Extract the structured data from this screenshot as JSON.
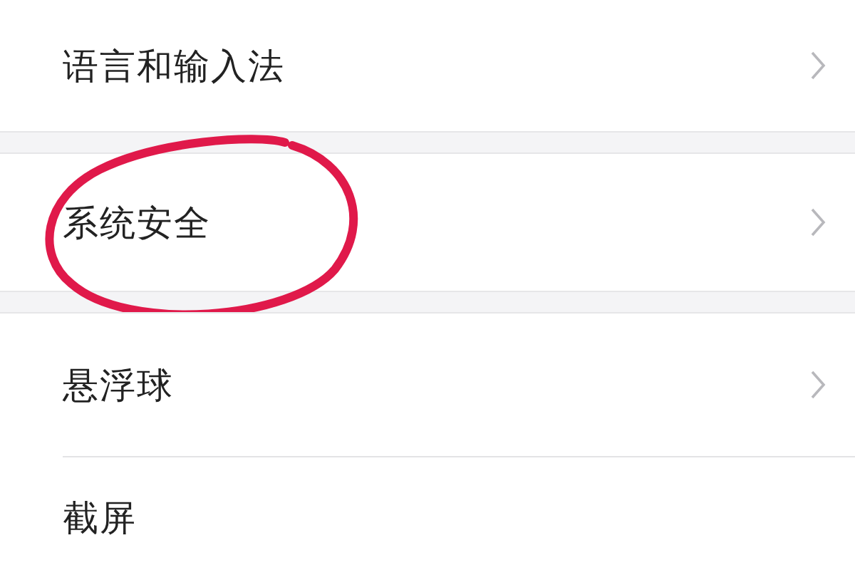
{
  "groups": [
    {
      "items": [
        {
          "label": "语言和输入法",
          "chevron": true
        }
      ]
    },
    {
      "items": [
        {
          "label": "系统安全",
          "chevron": true,
          "circled": true
        }
      ]
    },
    {
      "items": [
        {
          "label": "悬浮球",
          "chevron": true
        },
        {
          "label": "截屏",
          "chevron": false
        }
      ]
    }
  ]
}
